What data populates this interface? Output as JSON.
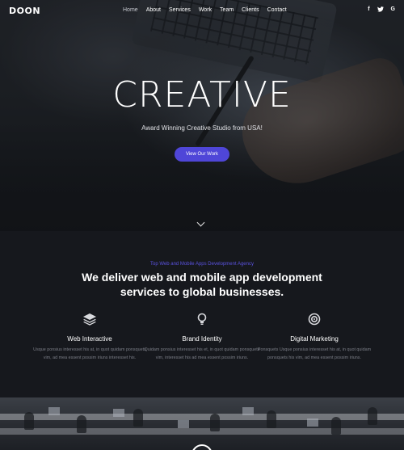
{
  "nav": {
    "logo": "DOON",
    "items": [
      "Home",
      "About",
      "Services",
      "Work",
      "Team",
      "Clients",
      "Contact"
    ],
    "active": "Home",
    "social": [
      "f",
      "y",
      "G"
    ]
  },
  "hero": {
    "title": "CREATIVE",
    "subtitle": "Award Winning Creative Studio from USA!",
    "cta_label": "View Our Work"
  },
  "services": {
    "eyebrow": "Top Web and Mobile Apps Development Agency",
    "headline": "We deliver web and mobile app development services to global businesses.",
    "features": [
      {
        "icon": "layers-icon",
        "title": "Web Interactive",
        "text": "Usque ponsius interesset his at, in quot quidam ponsquets vim, ad mea essent possim iriuns interesset his."
      },
      {
        "icon": "lightbulb-icon",
        "title": "Brand Identity",
        "text": "Quidam ponsius interesset his et, in quot quidam ponsquets vim, interesset his ad mea essent possim iriuns."
      },
      {
        "icon": "target-icon",
        "title": "Digital Marketing",
        "text": "Ponsquets Usque ponsius interesset his at, in quot quidam ponsquets his vim, ad mea essent possim iriuns."
      }
    ]
  },
  "colors": {
    "accent": "#4f46d8",
    "eyebrow": "#5a52e0",
    "dark_bg": "#16181d"
  }
}
